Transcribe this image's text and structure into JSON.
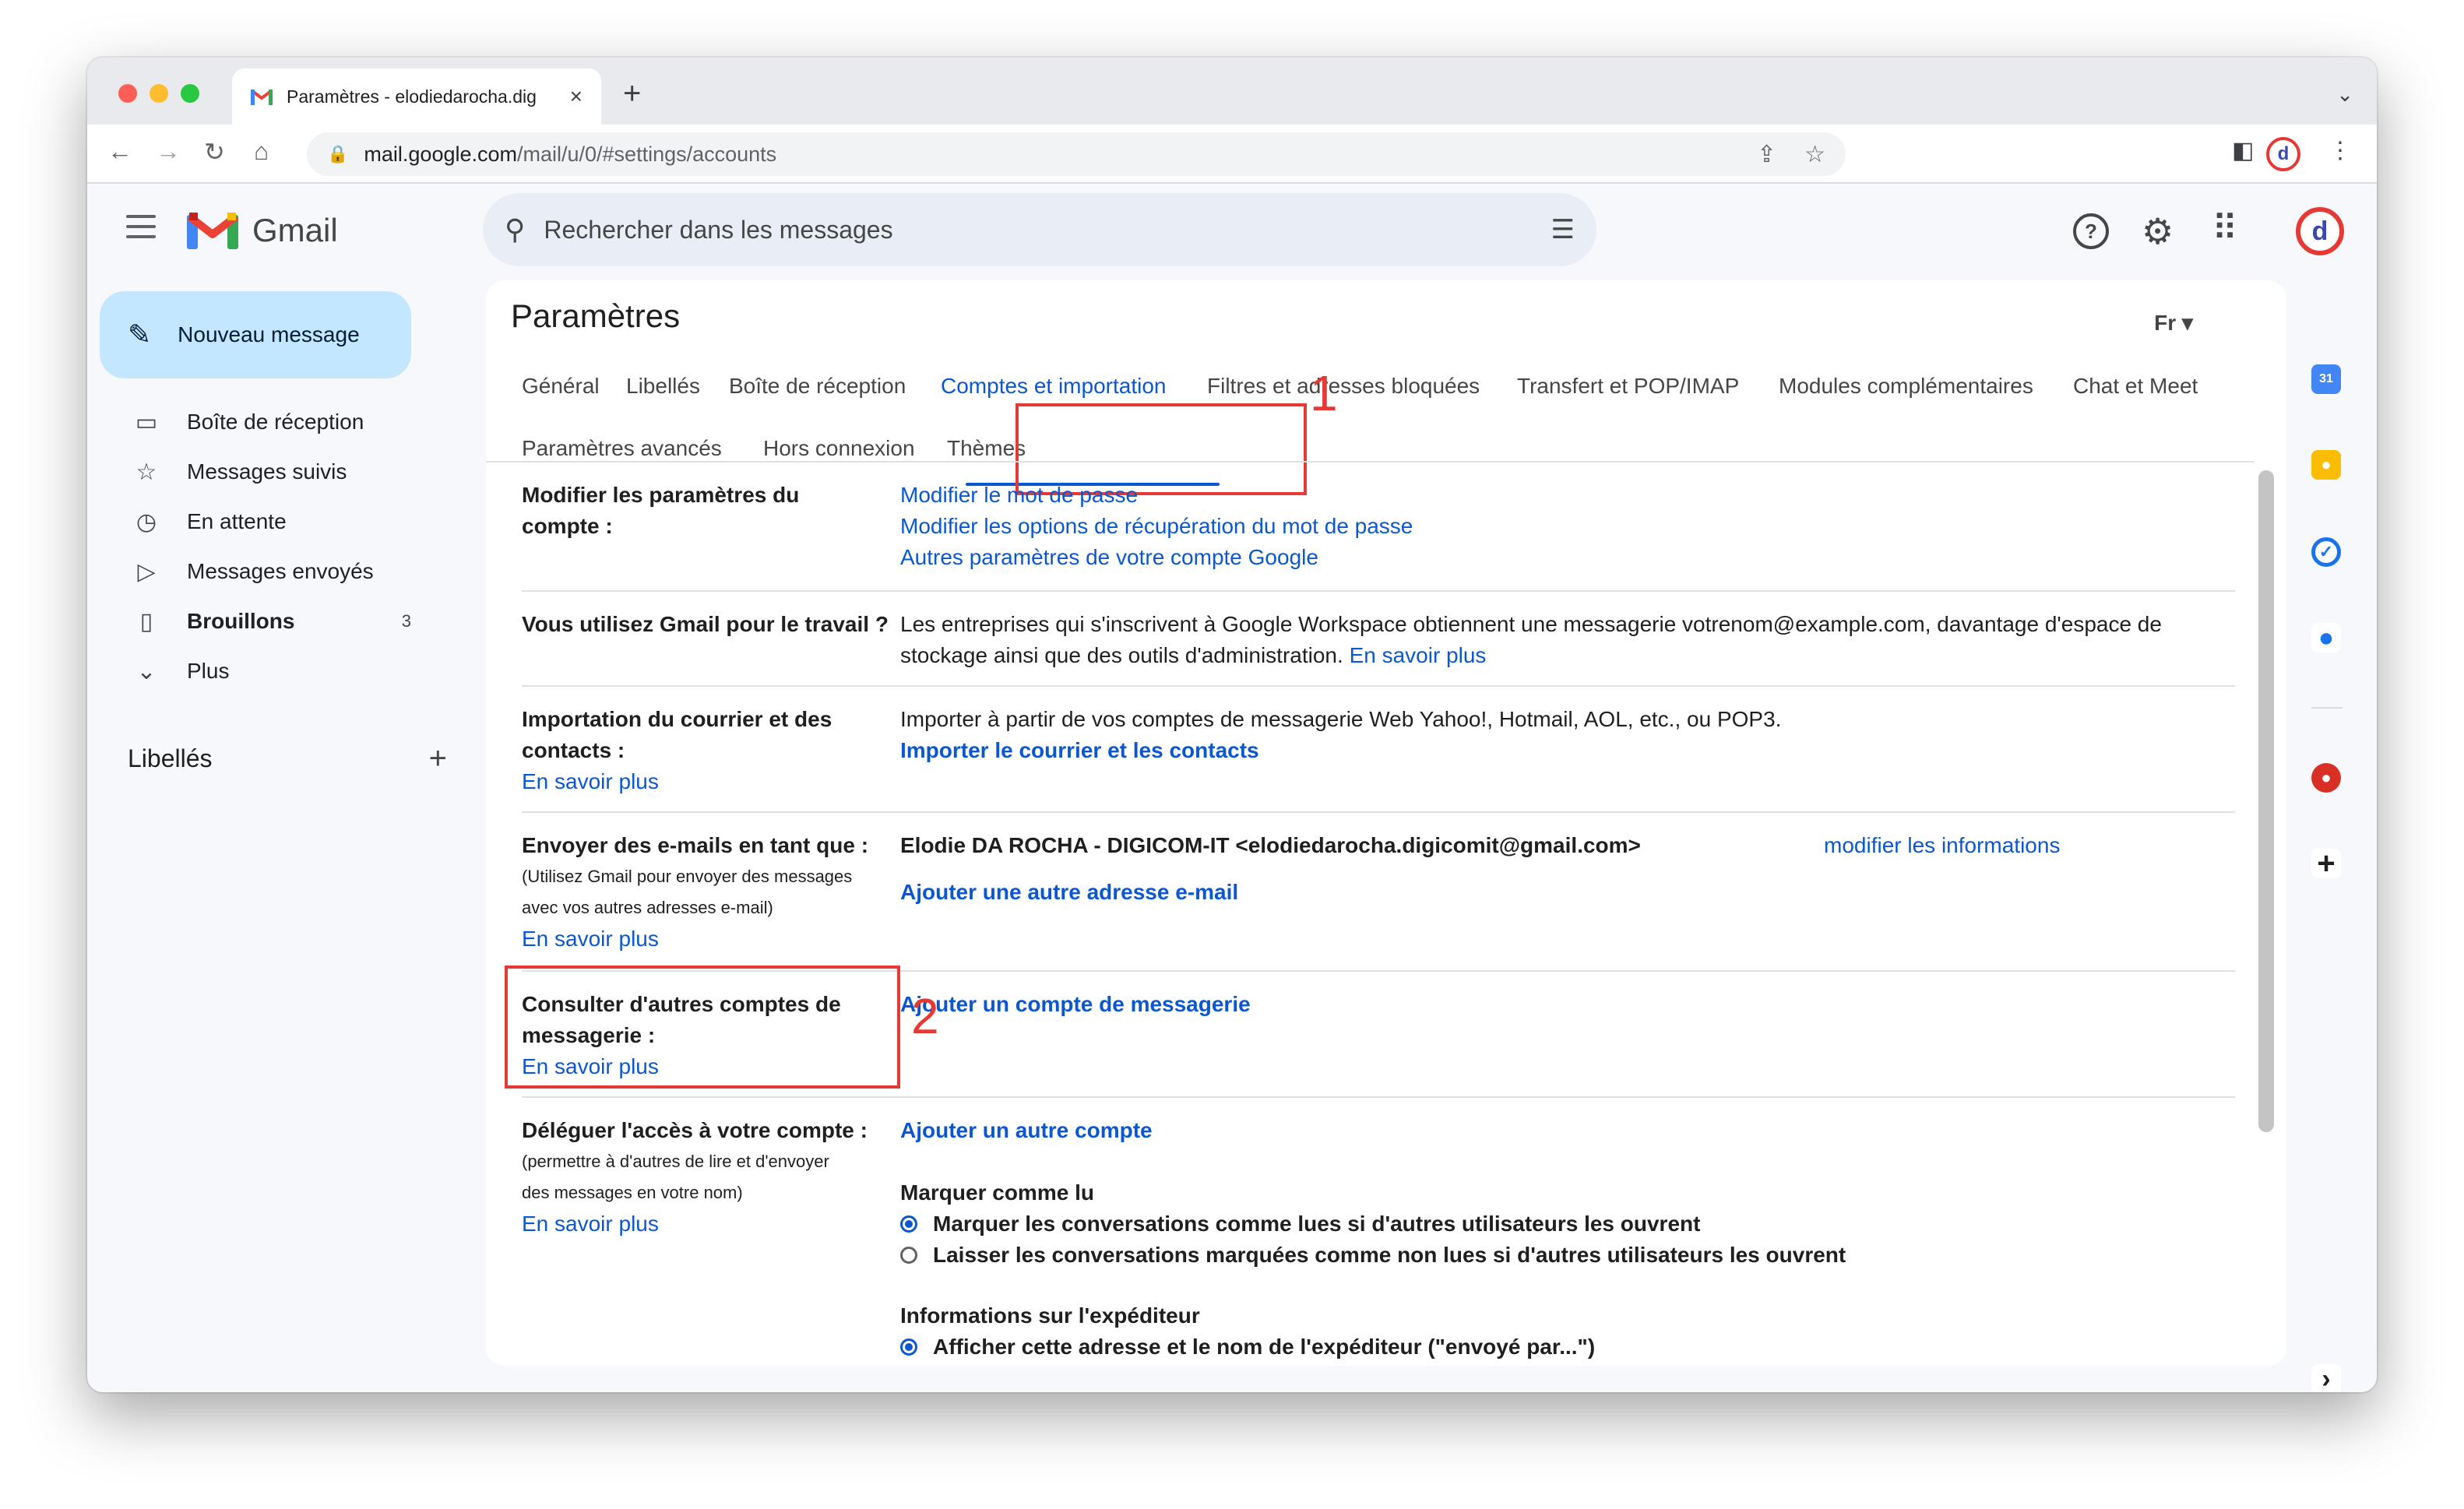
{
  "browser": {
    "tab_title": "Paramètres - elodiedarocha.dig",
    "url_host": "mail.google.com",
    "url_path": "/mail/u/0/#settings/accounts",
    "new_tab": "+"
  },
  "gmail": {
    "name": "Gmail",
    "search_placeholder": "Rechercher dans les messages",
    "avatar_letter": "d"
  },
  "sidebar": {
    "compose": "Nouveau message",
    "items": [
      {
        "label": "Boîte de réception",
        "icon": "inbox-icon",
        "count": ""
      },
      {
        "label": "Messages suivis",
        "icon": "star-icon",
        "count": ""
      },
      {
        "label": "En attente",
        "icon": "clock-icon",
        "count": ""
      },
      {
        "label": "Messages envoyés",
        "icon": "send-icon",
        "count": ""
      },
      {
        "label": "Brouillons",
        "icon": "draft-icon",
        "count": "3"
      },
      {
        "label": "Plus",
        "icon": "chevron-down-icon",
        "count": ""
      }
    ],
    "labels_heading": "Libellés"
  },
  "settings": {
    "title": "Paramètres",
    "lang": "Fr",
    "tabs": [
      "Général",
      "Libellés",
      "Boîte de réception",
      "Comptes et importation",
      "Filtres et adresses bloquées",
      "Transfert et POP/IMAP",
      "Modules complémentaires",
      "Chat et Meet",
      "Paramètres avancés",
      "Hors connexion",
      "Thèmes"
    ],
    "active_tab": "Comptes et importation",
    "annotations": [
      "1",
      "2"
    ],
    "rows": {
      "account": {
        "label_line1": "Modifier les paramètres du",
        "label_line2": "compte :",
        "links": [
          "Modifier le mot de passe",
          "Modifier les options de récupération du mot de passe",
          "Autres paramètres de votre compte Google"
        ]
      },
      "work": {
        "label": "Vous utilisez Gmail pour le travail ?",
        "text_line1": "Les entreprises qui s'inscrivent à Google Workspace obtiennent une messagerie votrenom@example.com, davantage d'espace de",
        "text_line2": "stockage ainsi que des outils d'administration.",
        "link": "En savoir plus"
      },
      "import": {
        "label_line1": "Importation du courrier et des",
        "label_line2": "contacts :",
        "learn": "En savoir plus",
        "text": "Importer à partir de vos comptes de messagerie Web Yahoo!, Hotmail, AOL, etc., ou POP3.",
        "link": "Importer le courrier et les contacts"
      },
      "sendas": {
        "label": "Envoyer des e-mails en tant que :",
        "sub_line1": "(Utilisez Gmail pour envoyer des messages",
        "sub_line2": "avec vos autres adresses e-mail)",
        "learn": "En savoir plus",
        "identity": "Elodie DA ROCHA - DIGICOM-IT <elodiedarocha.digicomit@gmail.com>",
        "edit": "modifier les informations",
        "add": "Ajouter une autre adresse e-mail"
      },
      "other": {
        "label_line1": "Consulter d'autres comptes de",
        "label_line2": "messagerie :",
        "learn": "En savoir plus",
        "link": "Ajouter un compte de messagerie"
      },
      "delegate": {
        "label": "Déléguer l'accès à votre compte :",
        "sub_line1": "(permettre à d'autres de lire et d'envoyer",
        "sub_line2": "des messages en votre nom)",
        "learn": "En savoir plus",
        "add": "Ajouter un autre compte",
        "mark_heading": "Marquer comme lu",
        "mark_opt1": "Marquer les conversations comme lues si d'autres utilisateurs les ouvrent",
        "mark_opt2": "Laisser les conversations marquées comme non lues si d'autres utilisateurs les ouvrent",
        "sender_heading": "Informations sur l'expéditeur",
        "sender_opt1": "Afficher cette adresse et le nom de l'expéditeur (\"envoyé par...\")"
      }
    }
  },
  "colors": {
    "accent": "#0b57d0",
    "annotation": "#e53935",
    "compose_bg": "#c2e7ff"
  }
}
